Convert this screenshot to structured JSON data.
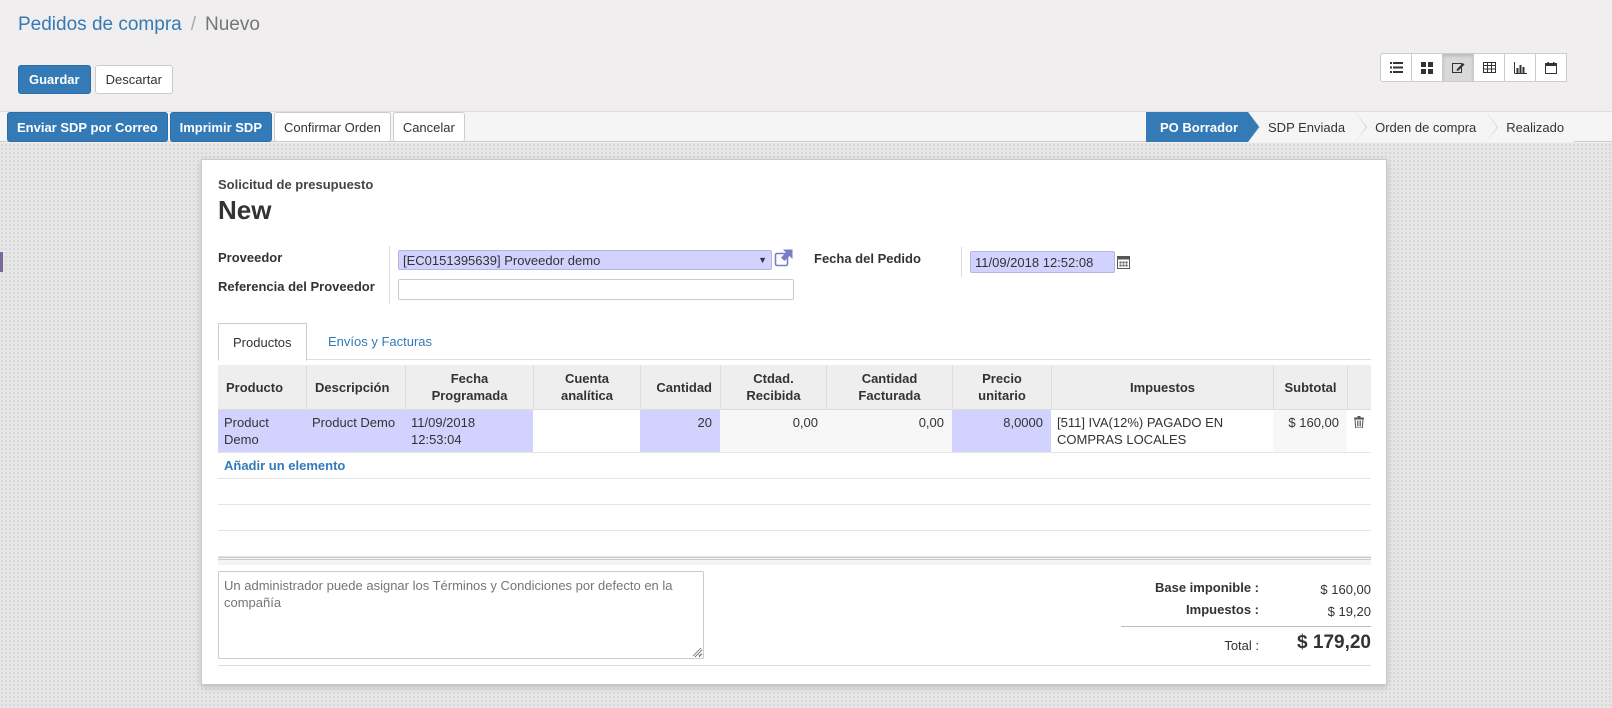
{
  "breadcrumb": {
    "parent": "Pedidos de compra",
    "current": "Nuevo"
  },
  "actions": {
    "save": "Guardar",
    "discard": "Descartar"
  },
  "view_switcher": [
    "list-view-icon",
    "kanban-view-icon",
    "form-view-icon",
    "pivot-view-icon",
    "graph-view-icon",
    "calendar-view-icon"
  ],
  "status_buttons": {
    "send_email": "Enviar SDP por Correo",
    "print": "Imprimir SDP",
    "confirm": "Confirmar Orden",
    "cancel": "Cancelar"
  },
  "status_steps": [
    "PO Borrador",
    "SDP Enviada",
    "Orden de compra",
    "Realizado"
  ],
  "form": {
    "doc_label": "Solicitud de presupuesto",
    "doc_name": "New",
    "vendor_label": "Proveedor",
    "vendor_value": "[EC0151395639] Proveedor demo",
    "vendor_ref_label": "Referencia del Proveedor",
    "vendor_ref_value": "",
    "order_date_label": "Fecha del Pedido",
    "order_date_value": "11/09/2018 12:52:08"
  },
  "tabs": [
    "Productos",
    "Envíos y Facturas"
  ],
  "lines": {
    "headers": [
      "Producto",
      "Descripción",
      "Fecha Programada",
      "Cuenta analítica",
      "Cantidad",
      "Ctdad. Recibida",
      "Cantidad Facturada",
      "Precio unitario",
      "Impuestos",
      "Subtotal"
    ],
    "rows": [
      {
        "product": "Product Demo",
        "description": "Product Demo",
        "date_planned": "11/09/2018 12:53:04",
        "analytic": "",
        "qty": "20",
        "qty_received": "0,00",
        "qty_invoiced": "0,00",
        "price_unit": "8,0000",
        "taxes": "[511] IVA(12%) PAGADO EN COMPRAS LOCALES",
        "subtotal": "$ 160,00"
      }
    ],
    "add_line": "Añadir un elemento"
  },
  "notes_placeholder": "Un administrador puede asignar los Términos y Condiciones por defecto en la compañía",
  "totals": {
    "untaxed_label": "Base imponible :",
    "untaxed_value": "$ 160,00",
    "taxes_label": "Impuestos :",
    "taxes_value": "$ 19,20",
    "total_label": "Total :",
    "total_value": "$ 179,20"
  },
  "colors": {
    "primary": "#337ab7",
    "required_field": "#d2d2ff"
  }
}
